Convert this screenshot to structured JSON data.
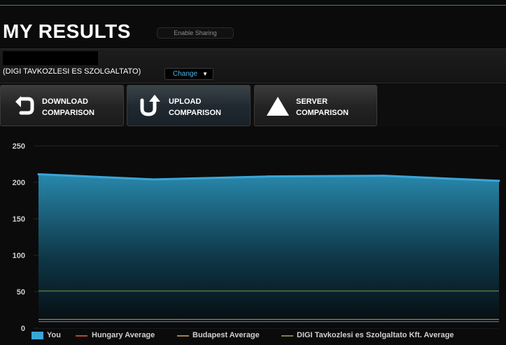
{
  "header": {
    "title": "MY RESULTS",
    "share_label": "Enable Sharing"
  },
  "isp": {
    "name": "(DIGI TAVKOZLESI ES SZOLGALTATO)",
    "change_label": "Change",
    "change_caret": "▼"
  },
  "comparisons": [
    {
      "line1": "DOWNLOAD",
      "line2": "COMPARISON",
      "icon": "download-icon"
    },
    {
      "line1": "UPLOAD",
      "line2": "COMPARISON",
      "icon": "upload-icon"
    },
    {
      "line1": "SERVER",
      "line2": "COMPARISON",
      "icon": "server-icon"
    }
  ],
  "colors": {
    "you": "#3aa6d6",
    "hungary": "#b54a35",
    "budapest": "#a5814f",
    "digi": "#6b8a4a"
  },
  "chart_data": {
    "type": "area",
    "x": [
      1,
      2,
      3,
      4,
      5
    ],
    "ylim": [
      0,
      250
    ],
    "yticks": [
      0,
      50,
      100,
      150,
      200,
      250
    ],
    "grid": true,
    "legend_placement": "bottom",
    "series": [
      {
        "name": "You",
        "style": "area",
        "values": [
          211,
          204,
          208,
          209,
          202
        ]
      },
      {
        "name": "Hungary Average",
        "style": "line",
        "values": [
          9,
          9,
          9,
          9,
          9
        ]
      },
      {
        "name": "Budapest Average",
        "style": "line",
        "values": [
          12,
          12,
          12,
          12,
          12
        ]
      },
      {
        "name": "DIGI Tavkozlesi es Szolgaltato Kft. Average",
        "style": "line",
        "values": [
          51,
          51,
          51,
          51,
          51
        ]
      }
    ]
  }
}
